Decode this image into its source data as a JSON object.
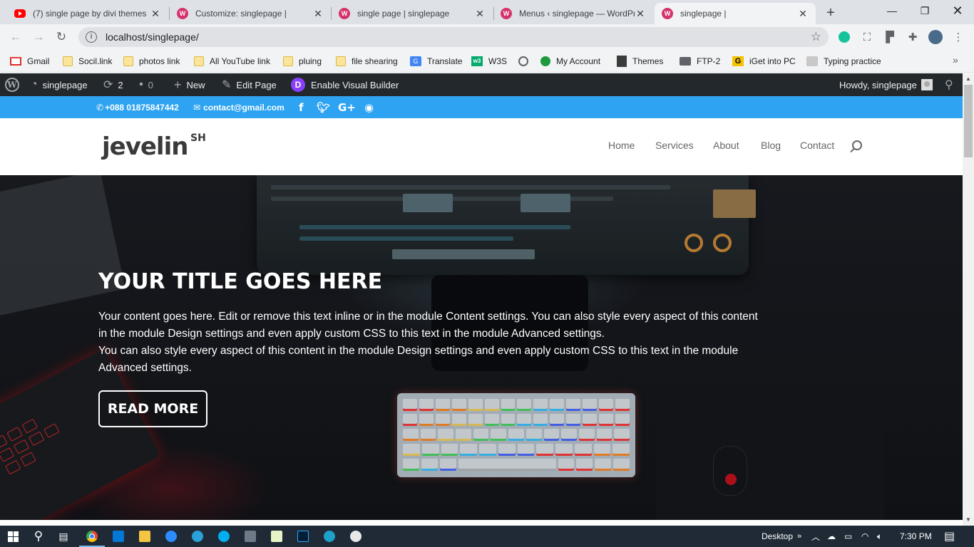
{
  "tabs": [
    {
      "title": "(7) single page by divi themes",
      "icon": "youtube-icon"
    },
    {
      "title": "Customize: singlepage |",
      "icon": "wp-multisite-icon"
    },
    {
      "title": "single page | singlepage",
      "icon": "wp-multisite-icon"
    },
    {
      "title": "Menus ‹ singlepage — WordPr",
      "icon": "wp-multisite-icon"
    },
    {
      "title": "singlepage |",
      "icon": "wp-multisite-icon",
      "active": true
    }
  ],
  "address": {
    "url": "localhost/singlepage/"
  },
  "bookmarks": [
    {
      "label": "Gmail"
    },
    {
      "label": "Socil.link"
    },
    {
      "label": "photos link"
    },
    {
      "label": "All YouTube link"
    },
    {
      "label": "pluing"
    },
    {
      "label": "file shearing"
    },
    {
      "label": "Translate"
    },
    {
      "label": "W3S"
    },
    {
      "label": ""
    },
    {
      "label": "My Account"
    },
    {
      "label": "Themes"
    },
    {
      "label": "FTP-2"
    },
    {
      "label": "iGet into PC"
    },
    {
      "label": "Typing practice"
    }
  ],
  "adminbar": {
    "site_name": "singlepage",
    "updates_count": "2",
    "comments_count": "0",
    "new_label": "New",
    "edit_label": "Edit Page",
    "visual_builder_label": "Enable Visual Builder",
    "howdy": "Howdy, singlepage"
  },
  "topinfo": {
    "phone": "+088 01875847442",
    "email": "contact@gmail.com"
  },
  "header": {
    "logo_text": "jevelin",
    "logo_sup": "SH",
    "nav": [
      "Home",
      "Services",
      "About",
      "Blog",
      "Contact"
    ]
  },
  "hero": {
    "title": "YOUR TITLE GOES HERE",
    "lines": [
      "Your content goes here. Edit or remove this text inline or in the module Content settings. You can also style every aspect of this content",
      "in the module Design settings and even apply custom CSS to this text in the module Advanced settings.",
      "You can also style every aspect of this content in the module Design settings and even apply custom CSS to this text in the module",
      "Advanced settings."
    ],
    "button": "READ MORE"
  },
  "taskbar": {
    "desktop_label": "Desktop",
    "time": "7:30 PM"
  },
  "colors": {
    "accent_blue": "#2ea3f2",
    "admin_bar": "#23282d",
    "taskbar": "#1f2a36"
  }
}
